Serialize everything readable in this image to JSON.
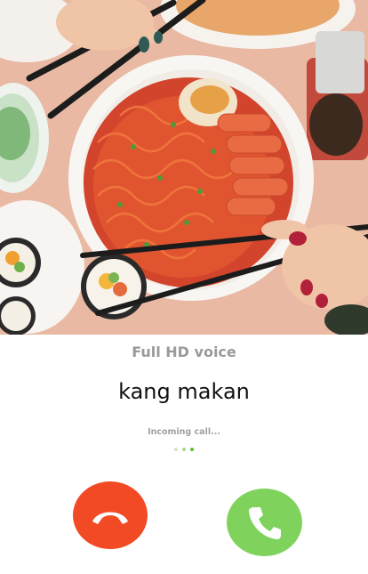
{
  "call": {
    "quality_label": "Full HD voice",
    "caller_name": "kang makan",
    "status_text": "Incoming call..."
  },
  "indicator": {
    "dots": [
      "#cfe8c4",
      "#a8d98f",
      "#5cbf3a"
    ]
  },
  "actions": {
    "decline_color": "#f24a24",
    "answer_color": "#7fd35c"
  },
  "photo": {
    "icon": "food-photo-background"
  }
}
